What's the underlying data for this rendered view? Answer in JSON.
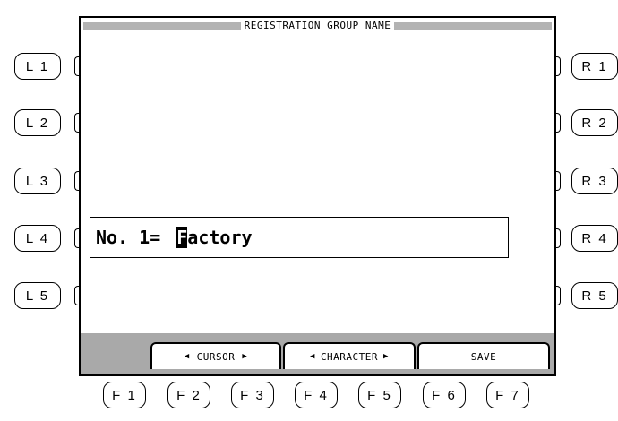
{
  "screen": {
    "title": "REGISTRATION GROUP NAME",
    "name_field": {
      "label": "No. 1=",
      "cursor_char": "F",
      "rest": "actory"
    },
    "function_bar": {
      "cursor_label": "CURSOR",
      "character_label": "CHARACTER",
      "save_label": "SAVE",
      "arrow_left": "◀",
      "arrow_right": "▶"
    }
  },
  "left_buttons": [
    "L 1",
    "L 2",
    "L 3",
    "L 4",
    "L 5"
  ],
  "right_buttons": [
    "R 1",
    "R 2",
    "R 3",
    "R 4",
    "R 5"
  ],
  "function_buttons": [
    "F 1",
    "F 2",
    "F 3",
    "F 4",
    "F 5",
    "F 6",
    "F 7"
  ],
  "colors": {
    "screen_bg": "#ffffff",
    "title_stripe": "#b3b3b3",
    "function_bar": "#a9a9a9"
  }
}
